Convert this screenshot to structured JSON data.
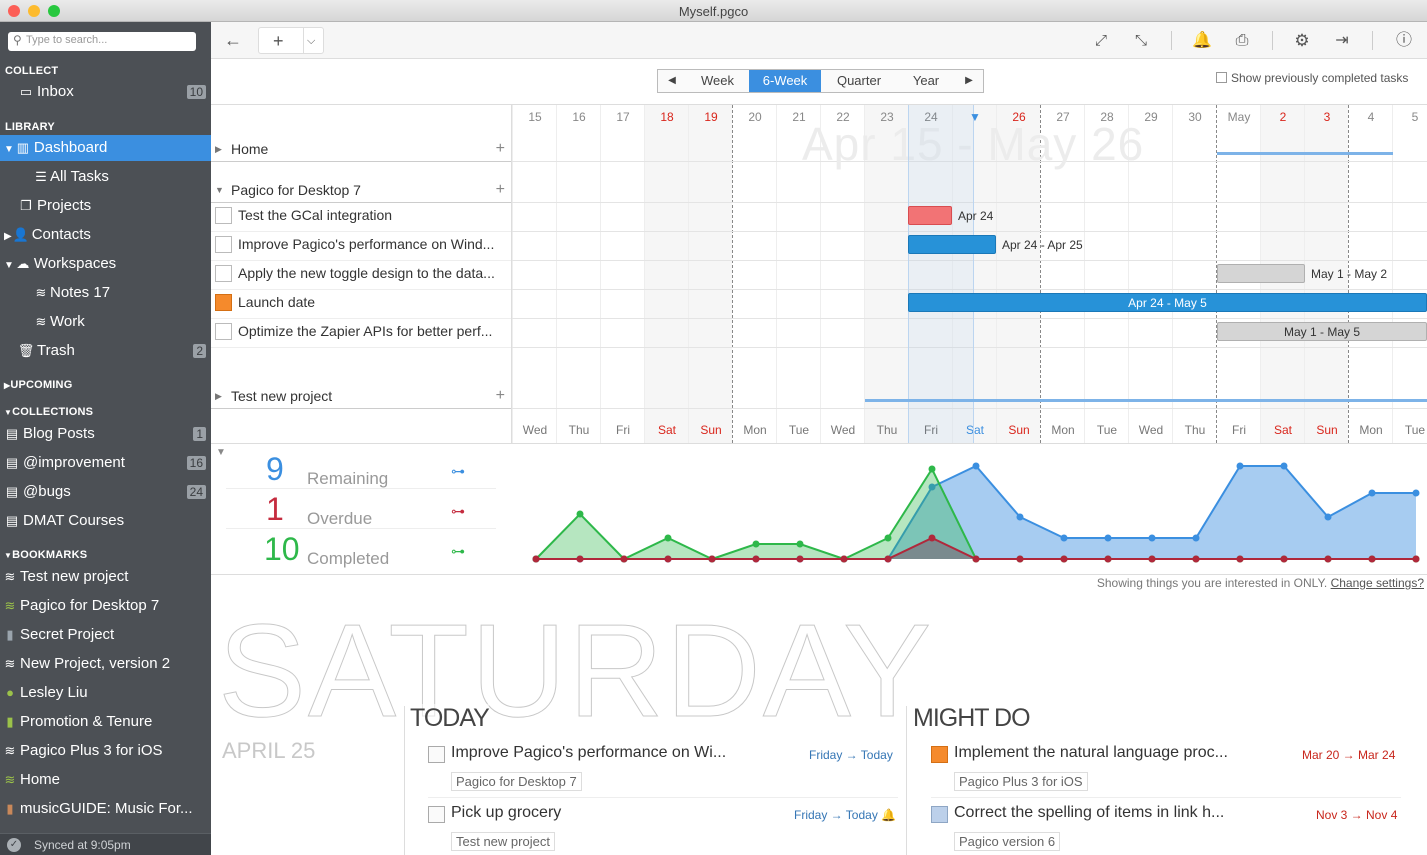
{
  "window": {
    "title": "Myself.pgco"
  },
  "search": {
    "placeholder": "Type to search..."
  },
  "sidebar": {
    "collect_header": "COLLECT",
    "inbox": {
      "label": "Inbox",
      "count": "10"
    },
    "library_header": "LIBRARY",
    "library": [
      {
        "label": "Dashboard"
      },
      {
        "label": "All Tasks"
      },
      {
        "label": "Projects"
      },
      {
        "label": "Contacts"
      },
      {
        "label": "Workspaces"
      },
      {
        "label": "Notes 17"
      },
      {
        "label": "Work"
      },
      {
        "label": "Trash",
        "count": "2"
      }
    ],
    "upcoming_header": "UPCOMING",
    "collections_header": "COLLECTIONS",
    "collections": [
      {
        "label": "Blog Posts",
        "count": "1"
      },
      {
        "label": "@improvement",
        "count": "16"
      },
      {
        "label": "@bugs",
        "count": "24"
      },
      {
        "label": "DMAT Courses"
      }
    ],
    "bookmarks_header": "BOOKMARKS",
    "bookmarks": [
      {
        "label": "Test new project"
      },
      {
        "label": "Pagico for Desktop 7"
      },
      {
        "label": "Secret Project"
      },
      {
        "label": "New Project, version 2"
      },
      {
        "label": "Lesley Liu"
      },
      {
        "label": "Promotion & Tenure"
      },
      {
        "label": "Pagico Plus 3 for iOS"
      },
      {
        "label": "Home"
      },
      {
        "label": "musicGUIDE: Music For..."
      }
    ],
    "sync_status": "Synced at 9:05pm"
  },
  "viewbar": {
    "segments": [
      "Week",
      "6-Week",
      "Quarter",
      "Year"
    ],
    "selected": "6-Week",
    "show_completed": "Show previously completed tasks"
  },
  "timeline": {
    "watermark": "Apr 15 - May 26",
    "day_numbers": [
      "15",
      "16",
      "17",
      "18",
      "19",
      "20",
      "21",
      "22",
      "23",
      "24",
      "",
      "26",
      "27",
      "28",
      "29",
      "30",
      "May",
      "2",
      "3",
      "4",
      "5"
    ],
    "day_names": [
      "Wed",
      "Thu",
      "Fri",
      "Sat",
      "Sun",
      "Mon",
      "Tue",
      "Wed",
      "Thu",
      "Fri",
      "Sat",
      "Sun",
      "Mon",
      "Tue",
      "Wed",
      "Thu",
      "Fri",
      "Sat",
      "Sun",
      "Mon",
      "Tue"
    ],
    "groups": [
      {
        "label": "Home"
      },
      {
        "label": "Pagico for Desktop 7"
      },
      {
        "label": "Test new project"
      }
    ],
    "tasks": [
      {
        "label": "Test the GCal integration",
        "range": "Apr 24"
      },
      {
        "label": "Improve Pagico's performance on Wind...",
        "range": "Apr 24 - Apr 25"
      },
      {
        "label": "Apply the new toggle design to the data...",
        "range": "May 1 - May 2"
      },
      {
        "label": "Launch date",
        "range": "Apr 24 - May 5"
      },
      {
        "label": "Optimize the Zapier APIs for better perf...",
        "range": "May 1 - May 5"
      }
    ]
  },
  "stats": {
    "remaining": {
      "value": "9",
      "label": "Remaining"
    },
    "overdue": {
      "value": "1",
      "label": "Overdue"
    },
    "completed": {
      "value": "10",
      "label": "Completed"
    }
  },
  "chart_data": {
    "type": "area",
    "x": [
      "Wed",
      "Thu",
      "Fri",
      "Sat",
      "Sun",
      "Mon",
      "Tue",
      "Wed",
      "Thu",
      "Fri",
      "Sat",
      "Sun",
      "Mon",
      "Tue",
      "Wed",
      "Thu",
      "Fri",
      "Sat",
      "Sun",
      "Mon",
      "Tue"
    ],
    "series": [
      {
        "name": "Remaining",
        "values": [
          0,
          0,
          0,
          0,
          0,
          0,
          0,
          0,
          0,
          2.4,
          3.1,
          1.4,
          0.7,
          0.7,
          0.7,
          0.7,
          3.1,
          3.1,
          1.4,
          2.2,
          2.2
        ]
      },
      {
        "name": "Overdue",
        "values": [
          0,
          0,
          0,
          0,
          0,
          0,
          0,
          0,
          0,
          0.7,
          0,
          0,
          0,
          0,
          0,
          0,
          0,
          0,
          0,
          0,
          0
        ]
      },
      {
        "name": "Completed",
        "values": [
          0,
          1.5,
          0,
          0.7,
          0,
          0.5,
          0.5,
          0,
          0.7,
          3.0,
          0,
          0,
          0,
          0,
          0,
          0,
          0,
          0,
          0,
          0,
          0
        ]
      }
    ],
    "colors": {
      "remaining": "#3b8fe0",
      "overdue": "#b0283b",
      "completed": "#2eb84a"
    }
  },
  "filter_note": {
    "text": "Showing things you are interested in ONLY.",
    "link": "Change settings?"
  },
  "today": {
    "weekday": "SATURDAY",
    "date": "APRIL 25",
    "today_header": "TODAY",
    "might_header": "MIGHT DO",
    "today_tasks": [
      {
        "title": "Improve Pagico's performance on Wi...",
        "project": "Pagico for Desktop 7",
        "due": "Friday → Today"
      },
      {
        "title": "Pick up grocery",
        "project": "Test new project",
        "due": "Friday → Today"
      }
    ],
    "might_tasks": [
      {
        "title": "Implement the natural language proc...",
        "project": "Pagico Plus 3 for iOS",
        "due": "Mar 20 → Mar 24"
      },
      {
        "title": "Correct the spelling of items in link h...",
        "project": "Pagico version 6",
        "due": "Nov 3 → Nov 4"
      }
    ]
  }
}
